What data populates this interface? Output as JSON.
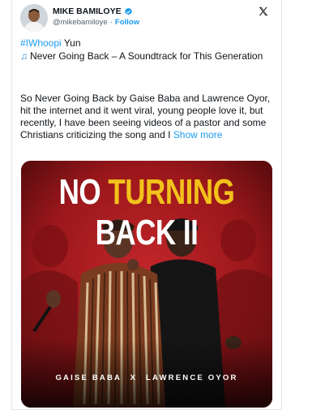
{
  "author": {
    "name": "MIKE BAMILOYE",
    "handle": "@mikebamiloye",
    "separator": "·",
    "follow_label": "Follow"
  },
  "icons": {
    "verified": "verified-badge-icon",
    "logo": "x-logo-icon",
    "note": "music-note-icon"
  },
  "tweet": {
    "hashtag": "#IWhoopi",
    "hashtag_rest": " Yun",
    "line2": "Never Going Back – A Soundtrack for This Generation",
    "paragraph": "So Never Going Back by Gaise Baba and Lawrence Oyor, hit the internet and it went viral, young people love it, but recently,  I have been seeing videos of a pastor and some Christians criticizing the song and I",
    "show_more": "Show more"
  },
  "poster": {
    "title_part1": "NO ",
    "title_part2": "TURNING",
    "title_part3": " BACK II",
    "artist1": "GAISE BABA",
    "x": "X",
    "artist2": "LAWRENCE OYOR"
  },
  "colors": {
    "accent": "#1d9bf0",
    "poster_red": "#b01b1f",
    "poster_yellow": "#f2c21b"
  }
}
